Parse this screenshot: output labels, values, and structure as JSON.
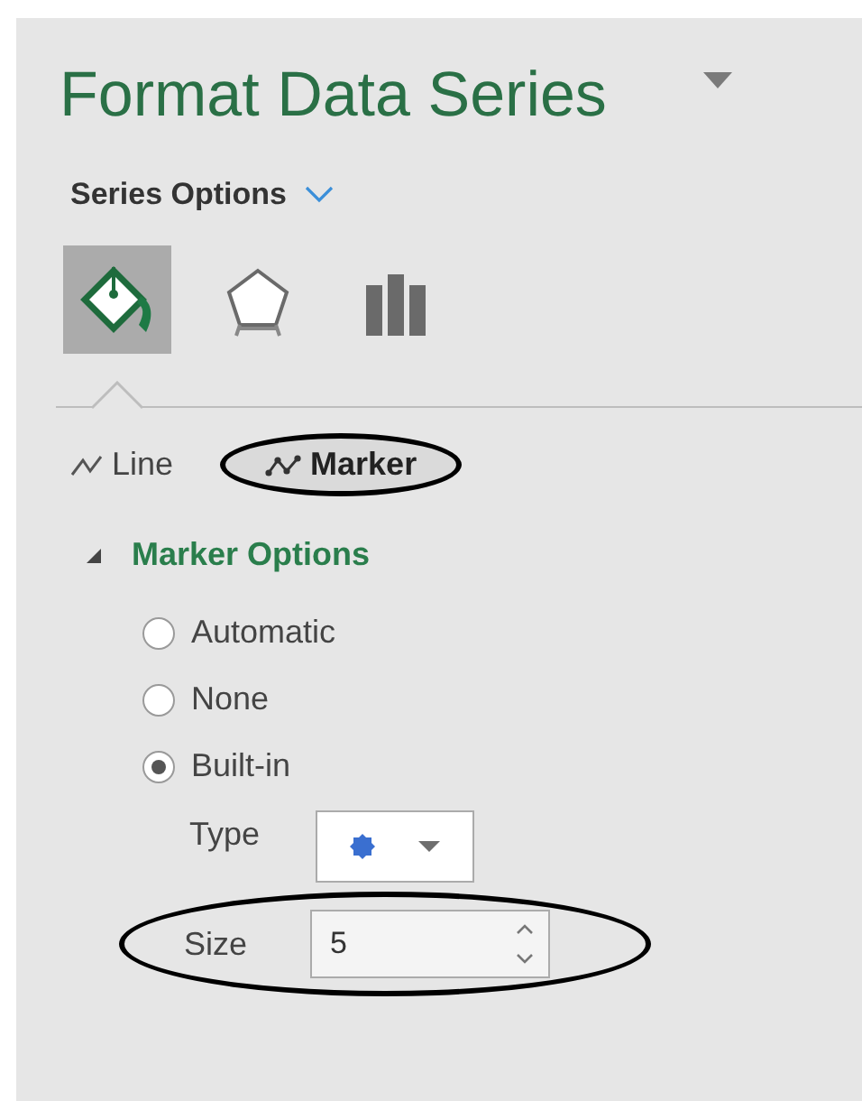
{
  "pane": {
    "title": "Format Data Series",
    "options_menu": {
      "label": "Series Options"
    }
  },
  "icon_tabs": [
    {
      "kind": "fill",
      "selected": true
    },
    {
      "kind": "effects",
      "selected": false
    },
    {
      "kind": "options",
      "selected": false
    }
  ],
  "sub_tabs": [
    {
      "kind": "line",
      "label": "Line",
      "selected": false,
      "circled": false
    },
    {
      "kind": "marker",
      "label": "Marker",
      "selected": true,
      "circled": true
    }
  ],
  "section": {
    "title": "Marker Options",
    "expanded": true
  },
  "radios": [
    {
      "label": "Automatic",
      "selected": false
    },
    {
      "label": "None",
      "selected": false
    },
    {
      "label": "Built-in",
      "selected": true
    }
  ],
  "type_field": {
    "label": "Type"
  },
  "size_field": {
    "label": "Size",
    "value": "5",
    "circled": true
  }
}
